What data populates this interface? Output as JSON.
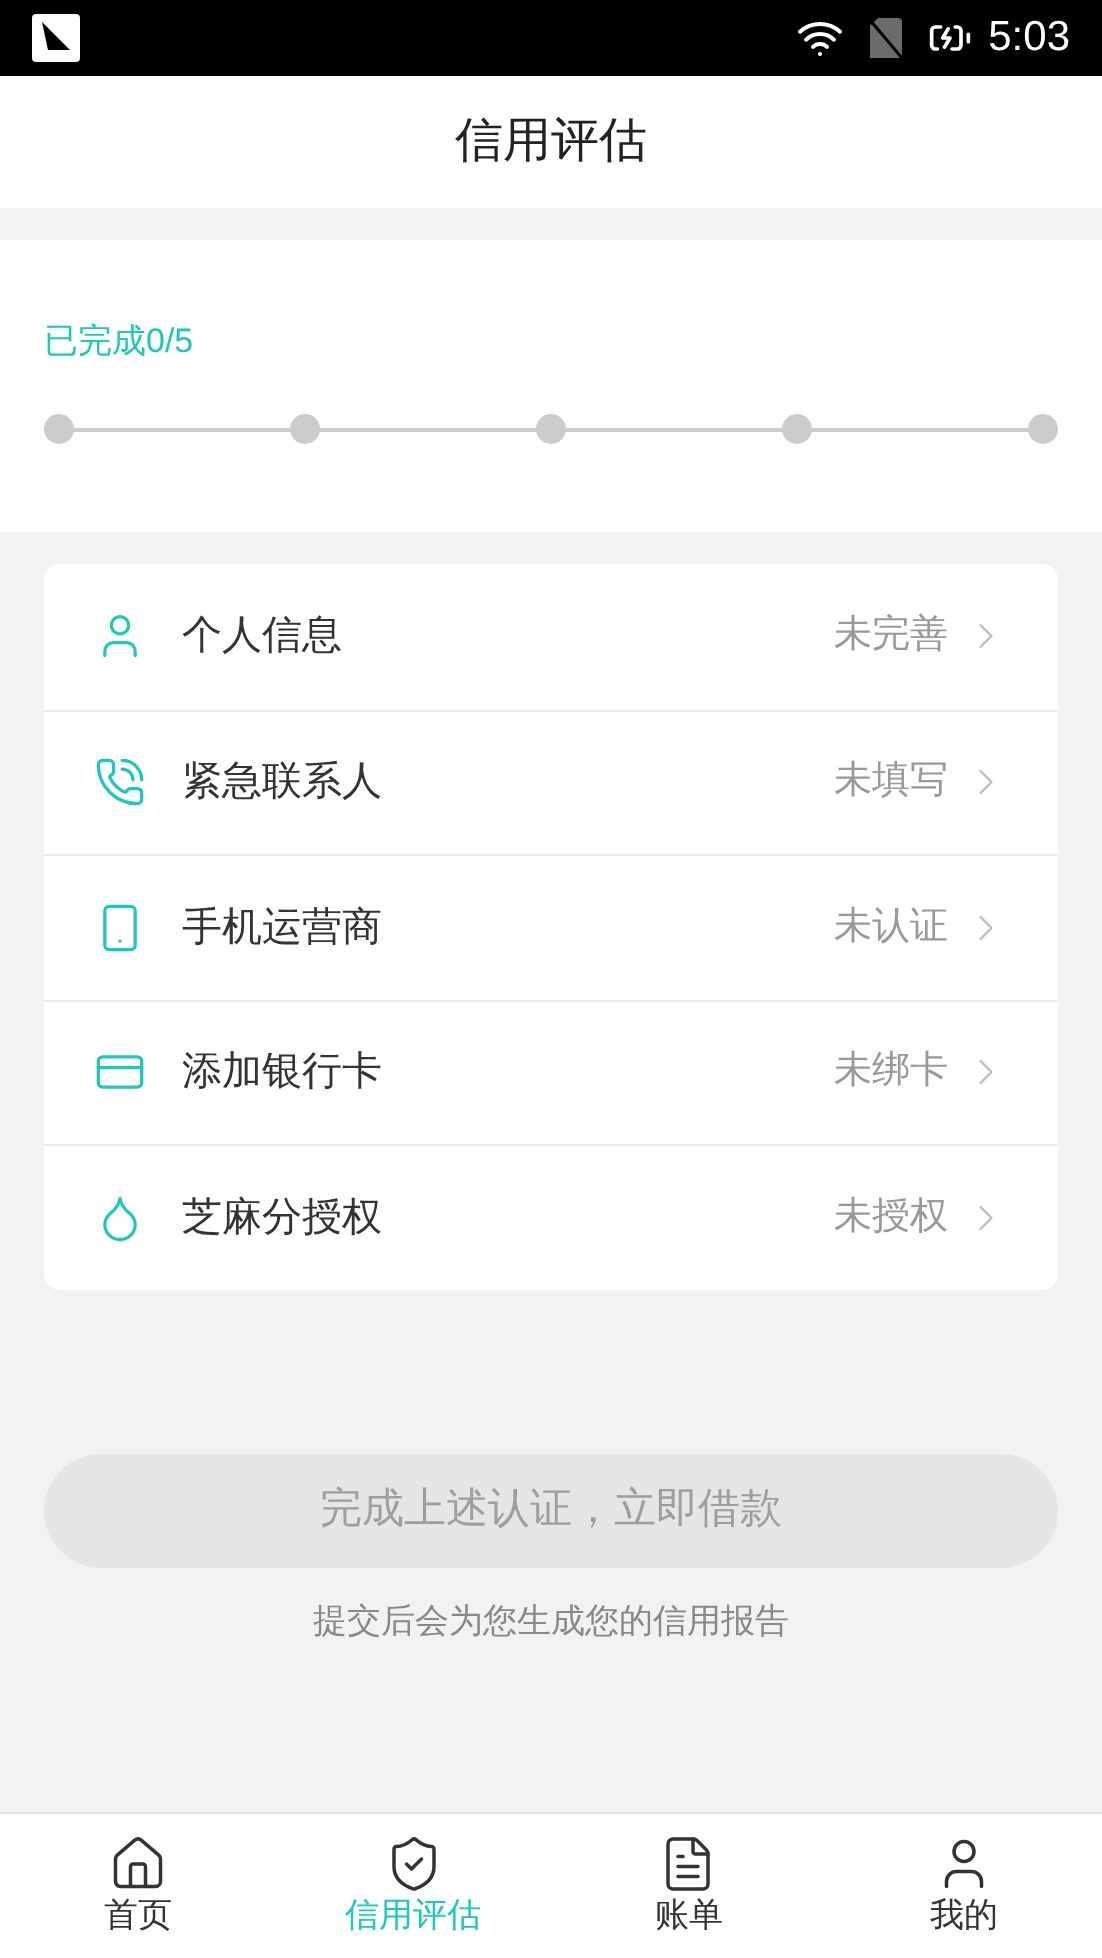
{
  "status_bar": {
    "time": "5:03"
  },
  "header": {
    "title": "信用评估"
  },
  "progress": {
    "label": "已完成0/5",
    "steps": [
      {
        "done": false
      },
      {
        "done": false
      },
      {
        "done": false
      },
      {
        "done": false
      },
      {
        "done": false
      }
    ]
  },
  "items": [
    {
      "kind": "person",
      "label": "个人信息",
      "status": "未完善"
    },
    {
      "kind": "phone",
      "label": "紧急联系人",
      "status": "未填写"
    },
    {
      "kind": "mobile",
      "label": "手机运营商",
      "status": "未认证"
    },
    {
      "kind": "card",
      "label": "添加银行卡",
      "status": "未绑卡"
    },
    {
      "kind": "drop",
      "label": "芝麻分授权",
      "status": "未授权"
    }
  ],
  "submit": {
    "label": "完成上述认证，立即借款",
    "disabled": true
  },
  "hint": "提交后会为您生成您的信用报告",
  "tabs": [
    {
      "kind": "home",
      "label": "首页",
      "selected": false
    },
    {
      "kind": "shield",
      "label": "信用评估",
      "selected": true
    },
    {
      "kind": "bill",
      "label": "账单",
      "selected": false
    },
    {
      "kind": "user",
      "label": "我的",
      "selected": false
    }
  ]
}
